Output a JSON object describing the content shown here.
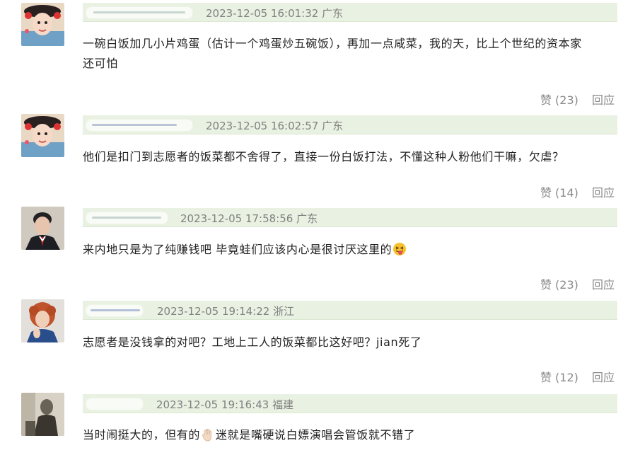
{
  "comments": [
    {
      "timestamp": "2023-12-05 16:01:32 广东",
      "text_line1": "一碗白饭加几小片鸡蛋（估计一个鸡蛋炒五碗饭），再加一点咸菜，我的天，比上个世纪的资本家",
      "text_line2": "还可怕",
      "like_label": "赞 (23)",
      "reply_label": "回应",
      "avatar": "avatar-qing-dynasty-girl"
    },
    {
      "timestamp": "2023-12-05 16:02:57 广东",
      "text_line1": "他们是扣门到志愿者的饭菜都不舍得了，直接一份白饭打法，不懂这种人粉他们干嘛，欠虐？",
      "like_label": "赞 (14)",
      "reply_label": "回应",
      "avatar": "avatar-qing-dynasty-girl"
    },
    {
      "timestamp": "2023-12-05 17:58:56 广东",
      "text_before_emoji": "来内地只是为了纯赚钱吧 毕竟蛙们应该内心是很讨厌这里的",
      "emoji": "tongue-out-face",
      "like_label": "赞 (23)",
      "reply_label": "回应",
      "avatar": "avatar-man-in-suit"
    },
    {
      "timestamp": "2023-12-05 19:14:22 浙江",
      "text_line1": "志愿者是没钱拿的对吧？工地上工人的饭菜都比这好吧？jian死了",
      "like_label": "赞 (12)",
      "reply_label": "回应",
      "avatar": "avatar-curly-red-hair"
    },
    {
      "timestamp": "2023-12-05 19:16:43 福建",
      "text_before_emoji": "当时闹挺大的，但有的",
      "emoji": "raised-hand",
      "text_after_emoji": "迷就是嘴硬说白嫖演唱会管饭就不错了",
      "avatar": "avatar-man-old-photo"
    }
  ]
}
